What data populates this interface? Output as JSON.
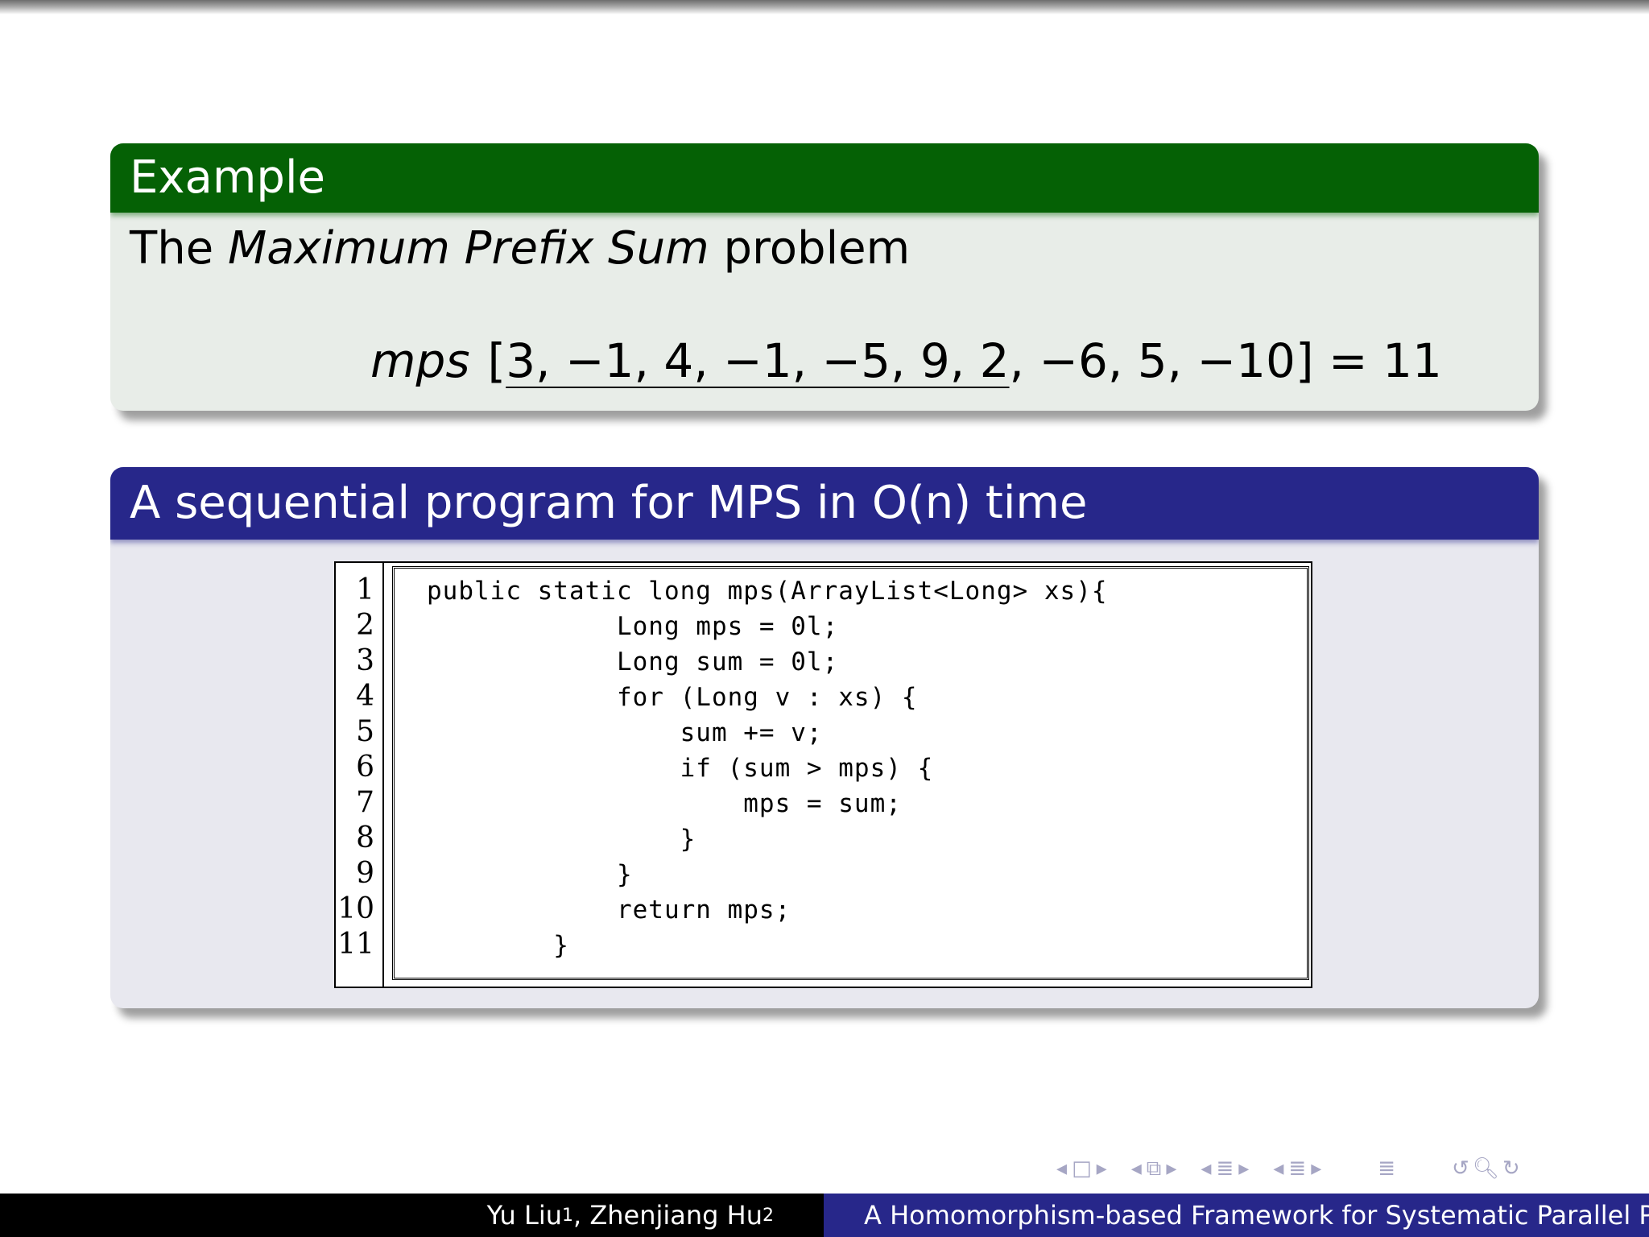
{
  "example": {
    "title": "Example",
    "text_before": "The ",
    "text_italic": "Maximum Prefix Sum",
    "text_after": " problem",
    "formula": {
      "fn": "mps",
      "open": "[",
      "prefix": "3, −1, 4, −1, −5, 9, 2",
      "rest": ", −6, 5, −10",
      "close": "]",
      "result": " = 11"
    }
  },
  "sequential": {
    "title": "A sequential program for MPS in O(n) time",
    "line_numbers": [
      "1",
      "2",
      "3",
      "4",
      "5",
      "6",
      "7",
      "8",
      "9",
      "10",
      "11"
    ],
    "code_lines": [
      "public static long mps(ArrayList<Long> xs){",
      "            Long mps = 0l;",
      "            Long sum = 0l;",
      "            for (Long v : xs) {",
      "                sum += v;",
      "                if (sum > mps) {",
      "                    mps = sum;",
      "                }",
      "            }",
      "            return mps;",
      "        }"
    ]
  },
  "nav": {
    "symbols": [
      "◂",
      "□",
      "▸",
      "◂",
      "⧉",
      "▸",
      "◂",
      "≣",
      "▸",
      "◂",
      "≣",
      "▸",
      "≣",
      "↺",
      "🔍︎",
      "↻"
    ]
  },
  "footer": {
    "author1": "Yu Liu",
    "author1_sup": "1",
    "author_sep": ", Zhenjiang Hu",
    "author2_sup": "2",
    "title": "A Homomorphism-based Framework for Systematic Parallel Programming"
  }
}
